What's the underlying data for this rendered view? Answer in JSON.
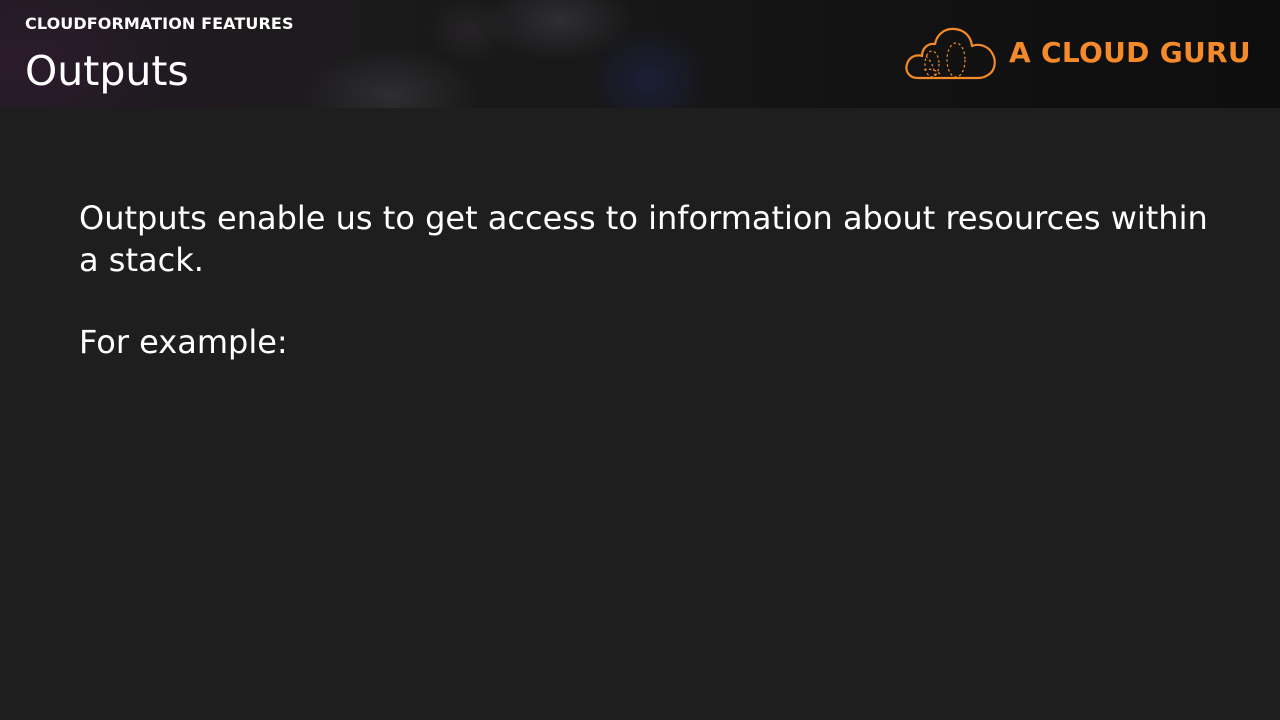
{
  "header": {
    "section_label": "CLOUDFORMATION FEATURES",
    "title": "Outputs",
    "logo": {
      "icon": "cloud-logo-icon",
      "text": "A CLOUD GURU",
      "color": "#f58a2a"
    }
  },
  "body": {
    "paragraph": "Outputs enable us to get access to information about resources within a stack.",
    "example_label": "For example:"
  },
  "colors": {
    "background": "#1e1e1e",
    "header_background": "#141414",
    "text": "#ffffff",
    "accent": "#f58a2a"
  }
}
